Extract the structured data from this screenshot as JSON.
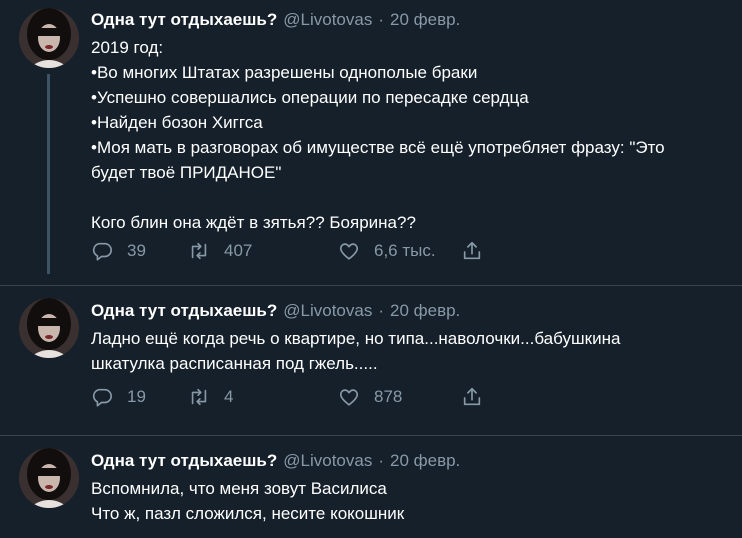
{
  "tweets": [
    {
      "name": "Одна тут отдыхаешь?",
      "handle": "@Livotovas",
      "separator": "·",
      "date": "20 февр.",
      "lines": [
        "2019 год:",
        "•Во многих Штатах разрешены однополые браки",
        "•Успешно совершались операции по пересадке сердца",
        "•Найден бозон Хиггса",
        "•Моя мать в разговорах об имуществе всё ещё употребляет фразу: \"Это",
        "будет твоё ПРИДАНОЕ\"",
        "",
        "Кого блин она ждёт в зятья?? Боярина??"
      ],
      "replies": "39",
      "retweets": "407",
      "likes": "6,6 тыс."
    },
    {
      "name": "Одна тут отдыхаешь?",
      "handle": "@Livotovas",
      "separator": "·",
      "date": "20 февр.",
      "lines": [
        "Ладно ещё когда речь о квартире, но типа...наволочки...бабушкина",
        "шкатулка расписанная под гжель....."
      ],
      "replies": "19",
      "retweets": "4",
      "likes": "878"
    },
    {
      "name": "Одна тут отдыхаешь?",
      "handle": "@Livotovas",
      "separator": "·",
      "date": "20 февр.",
      "lines": [
        "Вспомнила, что меня зовут Василиса",
        "Что ж, пазл сложился, несите кокошник"
      ]
    }
  ],
  "icons": {
    "reply": "reply-icon",
    "retweet": "retweet-icon",
    "like": "heart-icon",
    "share": "share-icon"
  },
  "colors": {
    "background": "#15202b",
    "secondary_text": "#8899a6",
    "divider": "#38444d",
    "thread_line": "#3d5466"
  }
}
